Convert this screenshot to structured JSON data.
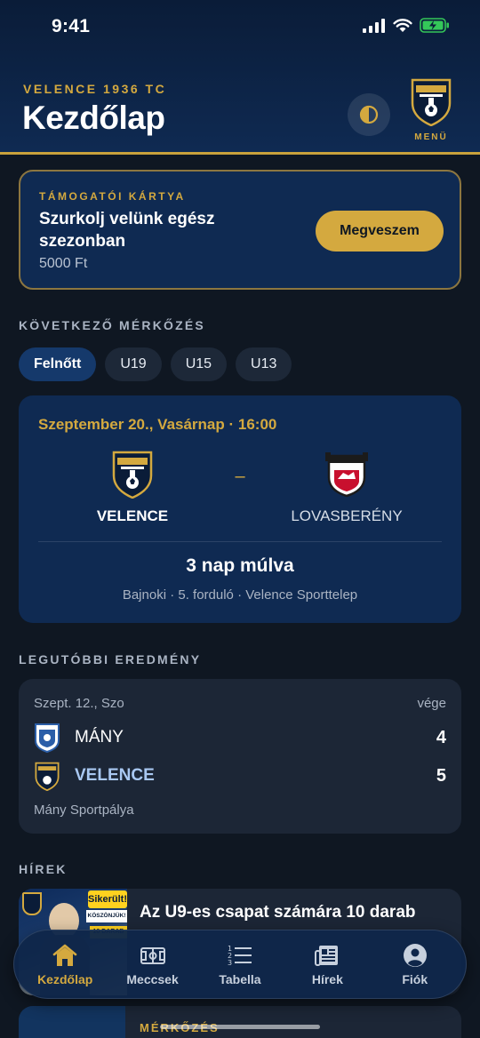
{
  "status_bar": {
    "time": "9:41"
  },
  "header": {
    "club_name": "VELENCE 1936 TC",
    "title": "Kezdőlap",
    "menu_label": "MENÜ"
  },
  "support_card": {
    "eyebrow": "TÁMOGATÓI KÁRTYA",
    "title": "Szurkolj velünk egész szezonban",
    "price": "5000 Ft",
    "button_label": "Megveszem"
  },
  "next_match": {
    "section_title": "KÖVETKEZŐ MÉRKŐZÉS",
    "tabs": [
      "Felnőtt",
      "U19",
      "U15",
      "U13"
    ],
    "active_tab": "Felnőtt",
    "date": "Szeptember 20., Vasárnap · 16:00",
    "home_team": "VELENCE",
    "away_team": "LOVASBERÉNY",
    "separator": "–",
    "countdown": "3 nap múlva",
    "info": "Bajnoki · 5. forduló · Velence Sporttelep"
  },
  "last_result": {
    "section_title": "LEGUTÓBBI EREDMÉNY",
    "date": "Szept. 12., Szo",
    "status": "vége",
    "teams": [
      {
        "name": "MÁNY",
        "score": "4"
      },
      {
        "name": "VELENCE",
        "score": "5"
      }
    ],
    "venue": "Mány Sportpálya"
  },
  "news": {
    "section_title": "HÍREK",
    "items": [
      {
        "title": "Az U9-es csapat számára 10 darab",
        "thumb_badge": "Sikerült!",
        "thumb_sub": "KÖSZÖNJÜK!",
        "thumb_count": "10 DARAB"
      },
      {
        "category": "MÉRKŐZÉS"
      }
    ]
  },
  "bottom_nav": [
    {
      "label": "Kezdőlap",
      "icon": "home-icon",
      "active": true
    },
    {
      "label": "Meccsek",
      "icon": "pitch-icon",
      "active": false
    },
    {
      "label": "Tabella",
      "icon": "list-numbered-icon",
      "active": false
    },
    {
      "label": "Hírek",
      "icon": "newspaper-icon",
      "active": false
    },
    {
      "label": "Fiók",
      "icon": "account-icon",
      "active": false
    }
  ],
  "colors": {
    "accent_gold": "#d4a93f",
    "navy": "#0f2a52",
    "background": "#0f1722",
    "card": "#1c2636"
  }
}
